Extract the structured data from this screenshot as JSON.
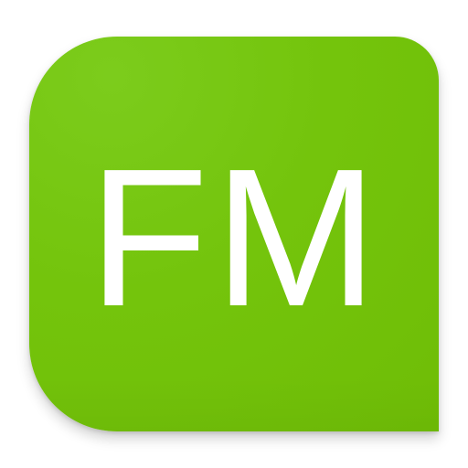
{
  "app_icon": {
    "label": "FM",
    "background_color": "#74c40c",
    "text_color": "#ffffff"
  }
}
